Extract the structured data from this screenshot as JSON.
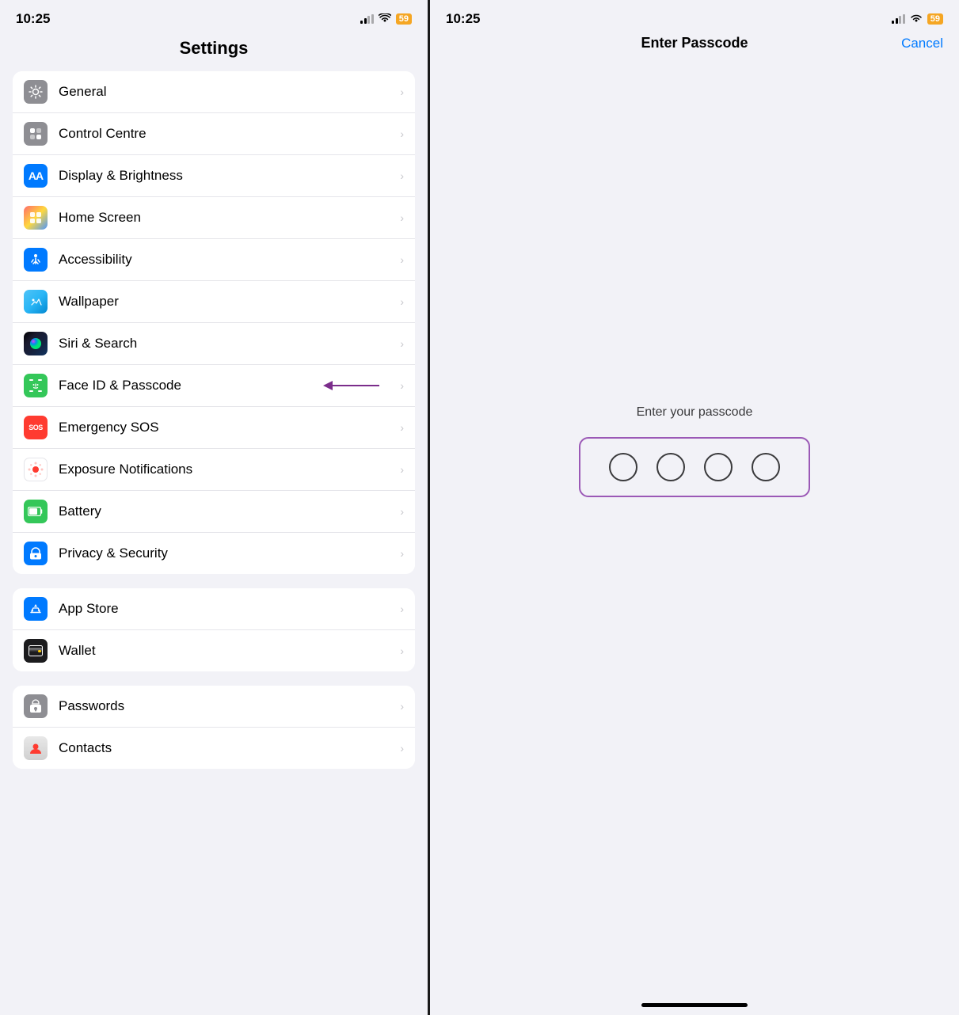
{
  "left": {
    "status": {
      "time": "10:25",
      "battery": "59"
    },
    "title": "Settings",
    "group1": {
      "items": [
        {
          "id": "general",
          "label": "General",
          "icon_type": "gear",
          "bg": "gray"
        },
        {
          "id": "control-centre",
          "label": "Control Centre",
          "icon_type": "sliders",
          "bg": "gray"
        },
        {
          "id": "display-brightness",
          "label": "Display & Brightness",
          "icon_type": "AA",
          "bg": "blue"
        },
        {
          "id": "home-screen",
          "label": "Home Screen",
          "icon_type": "grid",
          "bg": "multicolor"
        },
        {
          "id": "accessibility",
          "label": "Accessibility",
          "icon_type": "person",
          "bg": "blue"
        },
        {
          "id": "wallpaper",
          "label": "Wallpaper",
          "icon_type": "flower",
          "bg": "teal"
        },
        {
          "id": "siri-search",
          "label": "Siri & Search",
          "icon_type": "siri",
          "bg": "siri"
        },
        {
          "id": "face-id",
          "label": "Face ID & Passcode",
          "icon_type": "faceid",
          "bg": "green",
          "arrow": true
        },
        {
          "id": "emergency-sos",
          "label": "Emergency SOS",
          "icon_type": "sos",
          "bg": "red"
        },
        {
          "id": "exposure",
          "label": "Exposure Notifications",
          "icon_type": "exposure",
          "bg": "white"
        },
        {
          "id": "battery",
          "label": "Battery",
          "icon_type": "battery",
          "bg": "green"
        },
        {
          "id": "privacy",
          "label": "Privacy & Security",
          "icon_type": "hand",
          "bg": "blue"
        }
      ]
    },
    "group2": {
      "items": [
        {
          "id": "app-store",
          "label": "App Store",
          "icon_type": "appstore",
          "bg": "blue"
        },
        {
          "id": "wallet",
          "label": "Wallet",
          "icon_type": "wallet",
          "bg": "dark"
        }
      ]
    },
    "group3": {
      "items": [
        {
          "id": "passwords",
          "label": "Passwords",
          "icon_type": "key",
          "bg": "gray"
        },
        {
          "id": "contacts",
          "label": "Contacts",
          "icon_type": "contacts",
          "bg": "gray"
        }
      ]
    }
  },
  "right": {
    "status": {
      "time": "10:25",
      "battery": "59"
    },
    "title": "Enter Passcode",
    "cancel": "Cancel",
    "prompt": "Enter your passcode",
    "circles": 4
  }
}
